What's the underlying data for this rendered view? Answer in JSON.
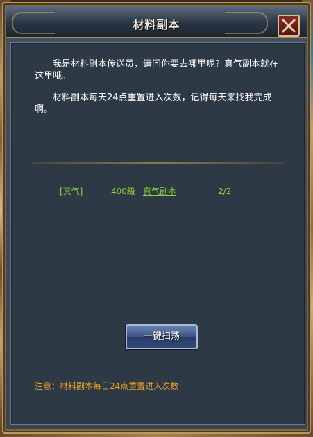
{
  "dialog": {
    "title": "材料副本",
    "close_icon": "close-x-icon"
  },
  "intro": {
    "paragraph1": "我是材料副本传送员，请问你要去哪里呢？真气副本就在这里哦。",
    "paragraph2": "材料副本每天24点重置进入次数，记得每天来找我完成啊。"
  },
  "entry": {
    "tag": "[真气]",
    "level": "400级",
    "link": "真气副本",
    "count": "2/2",
    "color": "#8cd23c"
  },
  "buttons": {
    "sweep_label": "一键扫荡"
  },
  "notice": {
    "text": "注意：材料副本每日24点重置进入次数",
    "color": "#f0a020"
  }
}
